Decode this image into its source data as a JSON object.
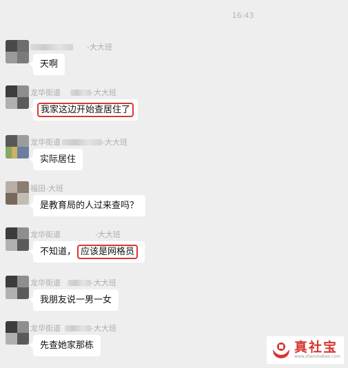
{
  "chat": {
    "timestamp": "16:43",
    "messages": [
      {
        "sender_name": "",
        "sender_suffix": "-大大班",
        "text": "天啊",
        "highlight": "none"
      },
      {
        "sender_name": "龙华街道",
        "sender_suffix": "-大大班",
        "text": "我家这边开始查居住了",
        "highlight": "all"
      },
      {
        "sender_name": "龙华街道",
        "sender_suffix": "-大大班",
        "text": "实际居住",
        "highlight": "none"
      },
      {
        "sender_name": "福田-大班",
        "sender_suffix": "",
        "text": "是教育局的人过来查吗？",
        "highlight": "none"
      },
      {
        "sender_name": "龙华街道",
        "sender_suffix": "-大大班",
        "text_plain": "不知道，",
        "text_hl": "应该是网格员",
        "highlight": "partial"
      },
      {
        "sender_name": "龙华街道",
        "sender_suffix": "-大大班",
        "text": "我朋友说一男一女",
        "highlight": "none"
      },
      {
        "sender_name": "龙华街道",
        "sender_suffix": "-大大班",
        "text": "先查她家那栋",
        "highlight": "none"
      }
    ]
  },
  "watermark": {
    "main": "真社宝",
    "sub": "www.zhenshebao.com",
    "color": "#d8352f"
  },
  "colors": {
    "background": "#eeeeee",
    "bubble": "#ffffff",
    "highlight_border": "#d8352f"
  }
}
